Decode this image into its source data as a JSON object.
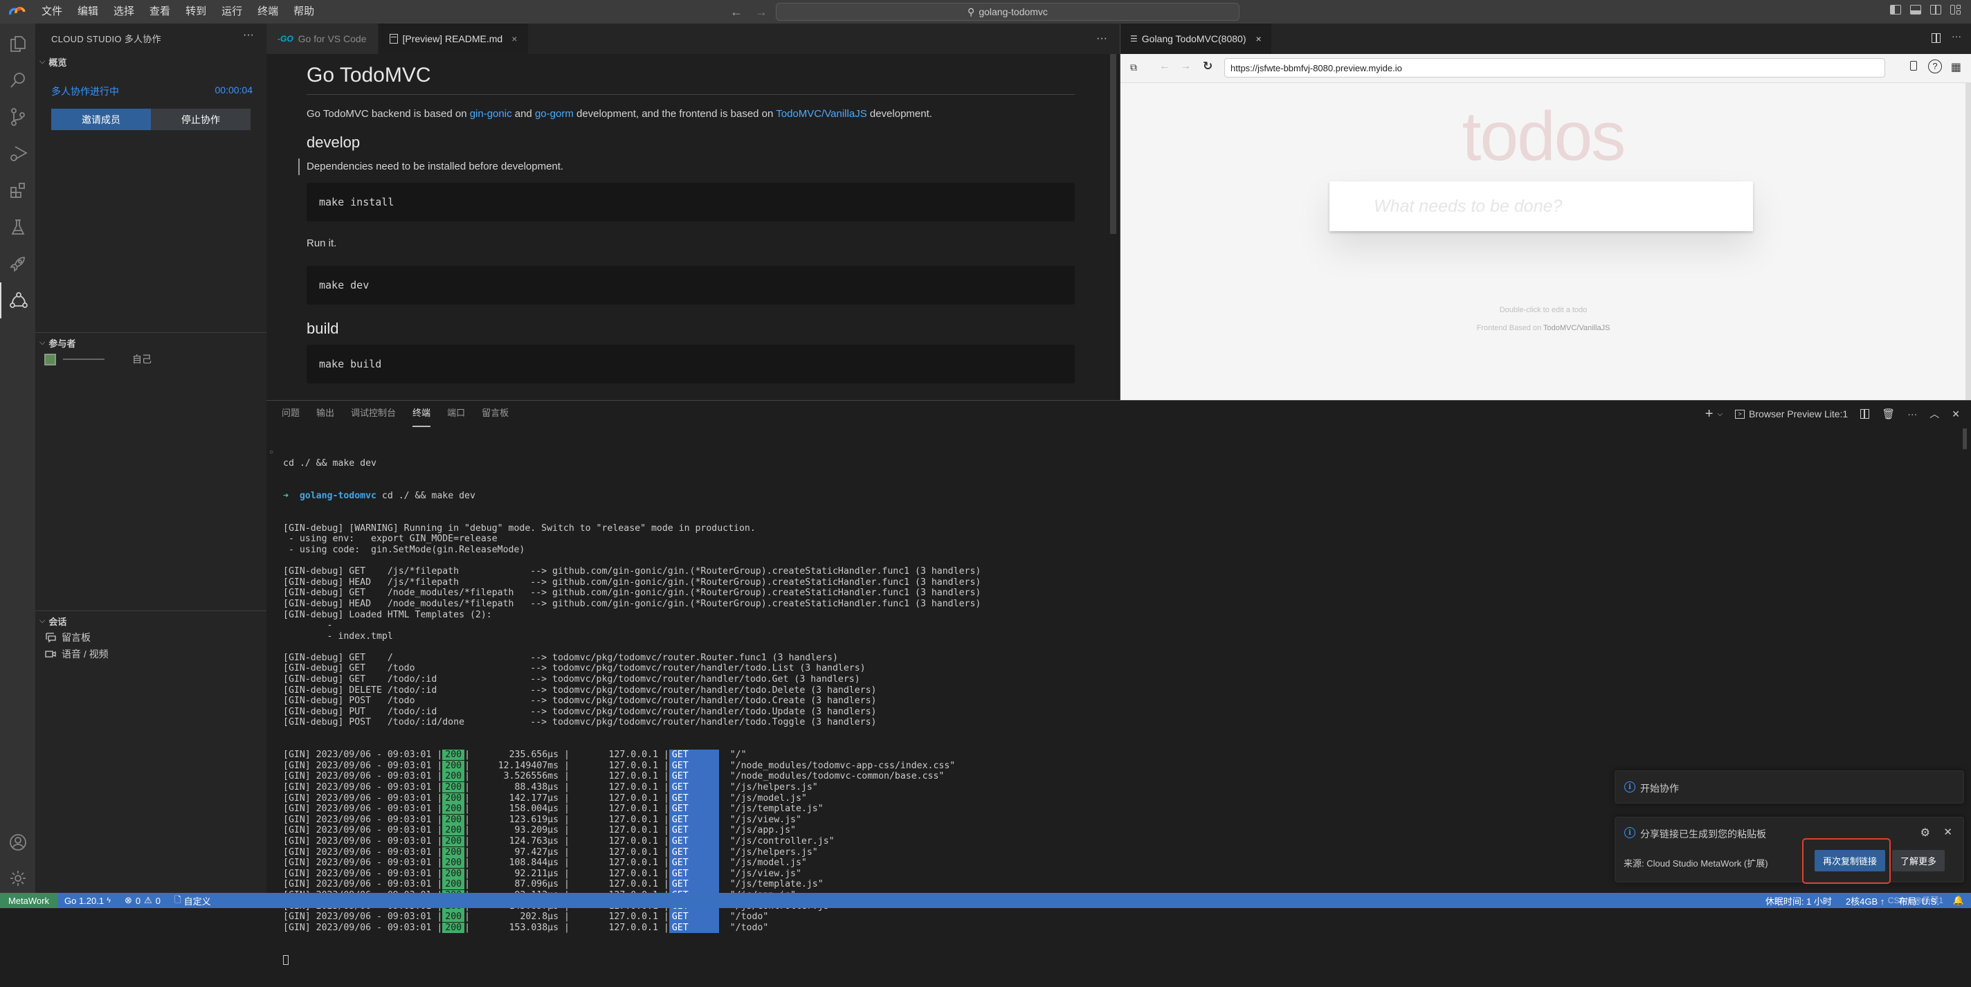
{
  "titlebar": {
    "menus": [
      "文件",
      "编辑",
      "选择",
      "查看",
      "转到",
      "运行",
      "终端",
      "帮助"
    ],
    "search": "golang-todomvc",
    "back": "←",
    "forward": "→"
  },
  "sidebar": {
    "title": "CLOUD STUDIO 多人协作",
    "more": "···",
    "overview": {
      "heading": "概览",
      "status": "多人协作进行中",
      "timer": "00:00:04",
      "invite_label": "邀请成员",
      "stop_label": "停止协作"
    },
    "participants": {
      "heading": "参与者",
      "items": [
        {
          "name": "",
          "tag": "自己"
        }
      ]
    },
    "session": {
      "heading": "会话",
      "items": [
        {
          "label": "留言板",
          "icon": "comment-board-icon"
        },
        {
          "label": "语音 / 视频",
          "icon": "video-camera-icon"
        }
      ]
    }
  },
  "editor": {
    "tabs": [
      {
        "label": "Go for VS Code",
        "icon": "go-icon",
        "active": false
      },
      {
        "label": "[Preview] README.md",
        "icon": "preview-icon",
        "active": true,
        "close": "×"
      }
    ],
    "more": "···",
    "markdown": {
      "h1": "Go TodoMVC",
      "intro": {
        "pre": "Go TodoMVC backend is based on ",
        "link1": "gin-gonic",
        "mid1": " and ",
        "link2": "go-gorm",
        "mid2": " development, and the frontend is based on ",
        "link3": "TodoMVC/VanillaJS",
        "post": " development."
      },
      "h2_develop": "develop",
      "deps": "Dependencies need to be installed before development.",
      "code_install": "make install",
      "run_it": "Run it.",
      "code_dev": "make dev",
      "h2_build": "build",
      "code_build": "make build"
    }
  },
  "preview": {
    "tab_label": "Golang TodoMVC(8080)",
    "tab_close": "×",
    "url": "https://jsfwte-bbmfvj-8080.preview.myide.io",
    "more": "···",
    "page": {
      "title": "todos",
      "input_placeholder": "What needs to be done?",
      "hint": "Double-click to edit a todo",
      "footer_pre": "Frontend Based on ",
      "footer_link": "TodoMVC/VanillaJS"
    }
  },
  "panel": {
    "tabs": [
      {
        "label": "问题",
        "active": false
      },
      {
        "label": "输出",
        "active": false
      },
      {
        "label": "调试控制台",
        "active": false
      },
      {
        "label": "终端",
        "active": true
      },
      {
        "label": "端口",
        "active": false
      },
      {
        "label": "留言板",
        "active": false
      }
    ],
    "terminal_name": "Browser Preview Lite:1",
    "terminal": {
      "command_echo": "cd ./ && make dev",
      "prompt_dir": "golang-todomvc",
      "prompt_cmd": " cd ./ && make dev",
      "lines": [
        "[GIN-debug] [WARNING] Running in \"debug\" mode. Switch to \"release\" mode in production.",
        " - using env:   export GIN_MODE=release",
        " - using code:  gin.SetMode(gin.ReleaseMode)",
        "",
        "[GIN-debug] GET    /js/*filepath             --> github.com/gin-gonic/gin.(*RouterGroup).createStaticHandler.func1 (3 handlers)",
        "[GIN-debug] HEAD   /js/*filepath             --> github.com/gin-gonic/gin.(*RouterGroup).createStaticHandler.func1 (3 handlers)",
        "[GIN-debug] GET    /node_modules/*filepath   --> github.com/gin-gonic/gin.(*RouterGroup).createStaticHandler.func1 (3 handlers)",
        "[GIN-debug] HEAD   /node_modules/*filepath   --> github.com/gin-gonic/gin.(*RouterGroup).createStaticHandler.func1 (3 handlers)",
        "[GIN-debug] Loaded HTML Templates (2):",
        "        - ",
        "        - index.tmpl",
        "",
        "[GIN-debug] GET    /                         --> todomvc/pkg/todomvc/router.Router.func1 (3 handlers)",
        "[GIN-debug] GET    /todo                     --> todomvc/pkg/todomvc/router/handler/todo.List (3 handlers)",
        "[GIN-debug] GET    /todo/:id                 --> todomvc/pkg/todomvc/router/handler/todo.Get (3 handlers)",
        "[GIN-debug] DELETE /todo/:id                 --> todomvc/pkg/todomvc/router/handler/todo.Delete (3 handlers)",
        "[GIN-debug] POST   /todo                     --> todomvc/pkg/todomvc/router/handler/todo.Create (3 handlers)",
        "[GIN-debug] PUT    /todo/:id                 --> todomvc/pkg/todomvc/router/handler/todo.Update (3 handlers)",
        "[GIN-debug] POST   /todo/:id/done            --> todomvc/pkg/todomvc/router/handler/todo.Toggle (3 handlers)"
      ],
      "requests": [
        {
          "ts": "2023/09/06 - 09:03:01",
          "status": "200",
          "latency": "235.656µs",
          "ip": "127.0.0.1",
          "method": "GET",
          "path": "\"/\""
        },
        {
          "ts": "2023/09/06 - 09:03:01",
          "status": "200",
          "latency": "12.149407ms",
          "ip": "127.0.0.1",
          "method": "GET",
          "path": "\"/node_modules/todomvc-app-css/index.css\""
        },
        {
          "ts": "2023/09/06 - 09:03:01",
          "status": "200",
          "latency": "3.526556ms",
          "ip": "127.0.0.1",
          "method": "GET",
          "path": "\"/node_modules/todomvc-common/base.css\""
        },
        {
          "ts": "2023/09/06 - 09:03:01",
          "status": "200",
          "latency": "88.438µs",
          "ip": "127.0.0.1",
          "method": "GET",
          "path": "\"/js/helpers.js\""
        },
        {
          "ts": "2023/09/06 - 09:03:01",
          "status": "200",
          "latency": "142.177µs",
          "ip": "127.0.0.1",
          "method": "GET",
          "path": "\"/js/model.js\""
        },
        {
          "ts": "2023/09/06 - 09:03:01",
          "status": "200",
          "latency": "158.004µs",
          "ip": "127.0.0.1",
          "method": "GET",
          "path": "\"/js/template.js\""
        },
        {
          "ts": "2023/09/06 - 09:03:01",
          "status": "200",
          "latency": "123.619µs",
          "ip": "127.0.0.1",
          "method": "GET",
          "path": "\"/js/view.js\""
        },
        {
          "ts": "2023/09/06 - 09:03:01",
          "status": "200",
          "latency": "93.209µs",
          "ip": "127.0.0.1",
          "method": "GET",
          "path": "\"/js/app.js\""
        },
        {
          "ts": "2023/09/06 - 09:03:01",
          "status": "200",
          "latency": "124.763µs",
          "ip": "127.0.0.1",
          "method": "GET",
          "path": "\"/js/controller.js\""
        },
        {
          "ts": "2023/09/06 - 09:03:01",
          "status": "200",
          "latency": "97.427µs",
          "ip": "127.0.0.1",
          "method": "GET",
          "path": "\"/js/helpers.js\""
        },
        {
          "ts": "2023/09/06 - 09:03:01",
          "status": "200",
          "latency": "108.844µs",
          "ip": "127.0.0.1",
          "method": "GET",
          "path": "\"/js/model.js\""
        },
        {
          "ts": "2023/09/06 - 09:03:01",
          "status": "200",
          "latency": "92.211µs",
          "ip": "127.0.0.1",
          "method": "GET",
          "path": "\"/js/view.js\""
        },
        {
          "ts": "2023/09/06 - 09:03:01",
          "status": "200",
          "latency": "87.096µs",
          "ip": "127.0.0.1",
          "method": "GET",
          "path": "\"/js/template.js\""
        },
        {
          "ts": "2023/09/06 - 09:03:01",
          "status": "200",
          "latency": "92.112µs",
          "ip": "127.0.0.1",
          "method": "GET",
          "path": "\"/js/app.js\""
        },
        {
          "ts": "2023/09/06 - 09:03:01",
          "status": "200",
          "latency": "145.097µs",
          "ip": "127.0.0.1",
          "method": "GET",
          "path": "\"/js/controller.js\""
        },
        {
          "ts": "2023/09/06 - 09:03:01",
          "status": "200",
          "latency": "202.8µs",
          "ip": "127.0.0.1",
          "method": "GET",
          "path": "\"/todo\""
        },
        {
          "ts": "2023/09/06 - 09:03:01",
          "status": "200",
          "latency": "153.038µs",
          "ip": "127.0.0.1",
          "method": "GET",
          "path": "\"/todo\""
        }
      ]
    }
  },
  "notifications": [
    {
      "message": "开始协作"
    },
    {
      "message": "分享链接已生成到您的粘贴板",
      "source": "来源: Cloud Studio MetaWork (扩展)",
      "primary_label": "再次复制链接",
      "secondary_label": "了解更多"
    }
  ],
  "statusbar": {
    "remote": "MetaWork",
    "go_version": "Go 1.20.1",
    "errors": "0",
    "warnings": "0",
    "custom": "自定义",
    "sleep": "休眠时间: 1 小时",
    "resources": "2核4GB ↑",
    "layout": "布局: U.S.",
    "watermark": "CSDN @杨琴1"
  },
  "colors": {
    "accent": "#3a70c0",
    "remote_bg": "#3c8a5c",
    "link": "#4daafc",
    "status_200": "#3fae68",
    "method_get": "#3a6fc4",
    "highlight_box": "#e0402a"
  }
}
